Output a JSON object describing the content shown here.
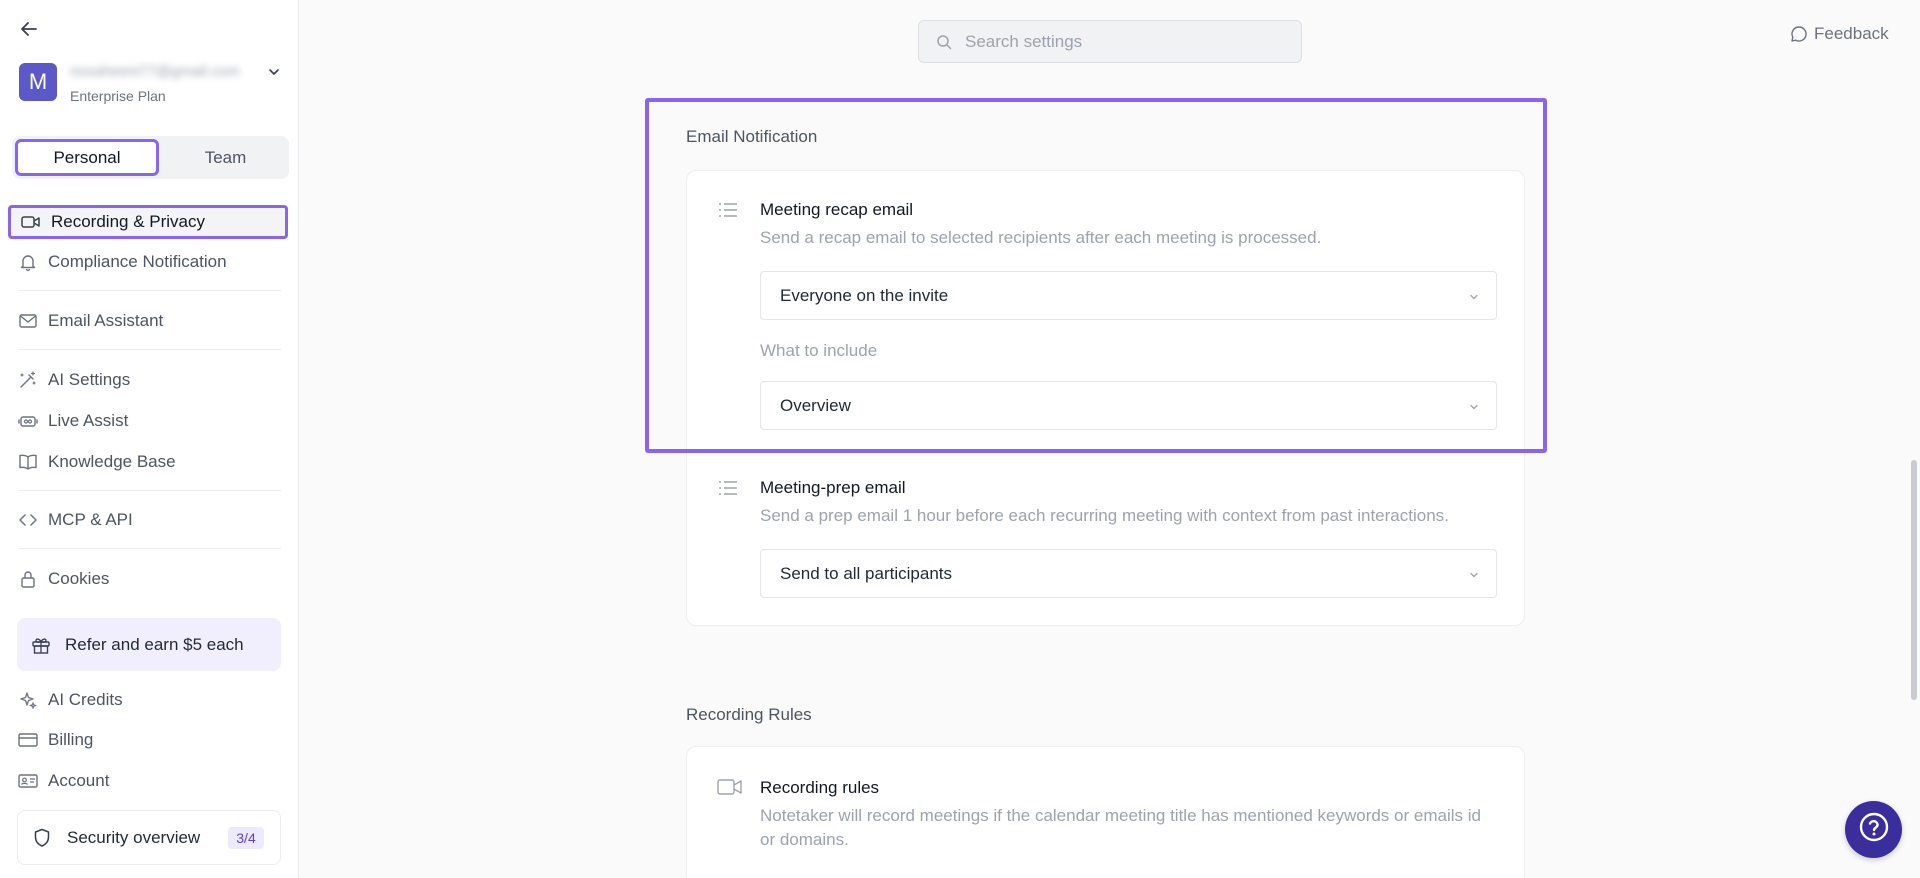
{
  "sidebar": {
    "account": {
      "avatar_letter": "M",
      "email": "noxaheeni77@gmail.com",
      "plan": "Enterprise Plan"
    },
    "segments": {
      "personal": "Personal",
      "team": "Team"
    },
    "items": [
      {
        "label": "Recording & Privacy",
        "icon": "video-camera-icon"
      },
      {
        "label": "Compliance Notification",
        "icon": "bell-icon"
      },
      {
        "label": "Email Assistant",
        "icon": "mail-icon"
      },
      {
        "label": "AI Settings",
        "icon": "magic-wand-icon"
      },
      {
        "label": "Live Assist",
        "icon": "live-assist-icon"
      },
      {
        "label": "Knowledge Base",
        "icon": "book-icon"
      },
      {
        "label": "MCP & API",
        "icon": "code-icon"
      },
      {
        "label": "Cookies",
        "icon": "lock-icon"
      },
      {
        "label": "AI Credits",
        "icon": "sparkles-icon"
      },
      {
        "label": "Billing",
        "icon": "credit-card-icon"
      },
      {
        "label": "Account",
        "icon": "id-card-icon"
      }
    ],
    "refer": {
      "label": "Refer and earn $5 each",
      "icon": "gift-icon"
    },
    "security": {
      "label": "Security overview",
      "badge": "3/4",
      "icon": "shield-icon"
    }
  },
  "header": {
    "search_placeholder": "Search settings",
    "feedback_label": "Feedback"
  },
  "email_notification": {
    "title": "Email Notification",
    "recap": {
      "title": "Meeting recap email",
      "description": "Send a recap email to selected recipients after each meeting is processed.",
      "recipients_value": "Everyone on the invite",
      "include_label": "What to include",
      "include_value": "Overview"
    },
    "prep": {
      "title": "Meeting-prep email",
      "description": "Send a prep email 1 hour before each recurring meeting with context from past interactions.",
      "value": "Send to all participants"
    }
  },
  "recording_rules": {
    "title": "Recording Rules",
    "rule": {
      "title": "Recording rules",
      "description": "Notetaker will record meetings if the calendar meeting title has mentioned keywords or emails id or domains."
    }
  },
  "colors": {
    "accent": "#8a63f5",
    "avatar": "#5b59c7",
    "help": "#3a2d9c"
  }
}
